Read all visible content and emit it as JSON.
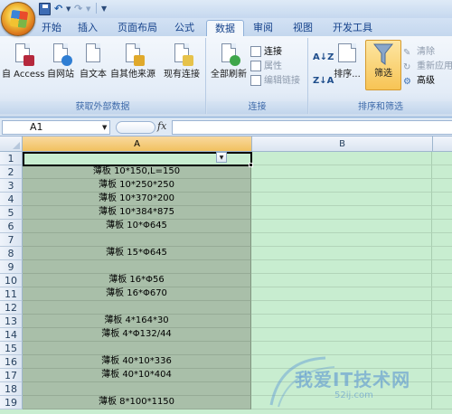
{
  "tabs": [
    "开始",
    "插入",
    "页面布局",
    "公式",
    "数据",
    "审阅",
    "视图",
    "开发工具"
  ],
  "active_tab": "数据",
  "ribbon": {
    "external": {
      "label": "获取外部数据",
      "buttons": [
        "自 Access",
        "自网站",
        "自文本",
        "自其他来源",
        "现有连接"
      ]
    },
    "connections": {
      "label": "连接",
      "refresh_all": "全部刷新",
      "connections": "连接",
      "properties": "属性",
      "edit_links": "编辑链接"
    },
    "sortfilter": {
      "label": "排序和筛选",
      "sort": "排序...",
      "filter": "筛选",
      "clear": "清除",
      "reapply": "重新应用",
      "advanced": "高级"
    }
  },
  "formula_bar": {
    "name_box": "A1",
    "fx": "fx",
    "value": ""
  },
  "grid": {
    "columns": [
      "A",
      "B"
    ],
    "rows": [
      {
        "n": "1",
        "a": ""
      },
      {
        "n": "2",
        "a": "薄板  10*150,L=150"
      },
      {
        "n": "3",
        "a": "薄板  10*250*250"
      },
      {
        "n": "4",
        "a": "薄板  10*370*200"
      },
      {
        "n": "5",
        "a": "薄板  10*384*875"
      },
      {
        "n": "6",
        "a": "薄板  10*Φ645"
      },
      {
        "n": "7",
        "a": ""
      },
      {
        "n": "8",
        "a": "薄板  15*Φ645"
      },
      {
        "n": "9",
        "a": ""
      },
      {
        "n": "10",
        "a": "薄板  16*Φ56"
      },
      {
        "n": "11",
        "a": "薄板  16*Φ670"
      },
      {
        "n": "12",
        "a": ""
      },
      {
        "n": "13",
        "a": "薄板  4*164*30"
      },
      {
        "n": "14",
        "a": "薄板  4*Φ132/44"
      },
      {
        "n": "15",
        "a": ""
      },
      {
        "n": "16",
        "a": "薄板  40*10*336"
      },
      {
        "n": "17",
        "a": "薄板  40*10*404"
      },
      {
        "n": "18",
        "a": ""
      },
      {
        "n": "19",
        "a": "薄板  8*100*1150"
      }
    ]
  },
  "watermark": {
    "text": "我爱IT技术网",
    "url": "52ij.com"
  }
}
